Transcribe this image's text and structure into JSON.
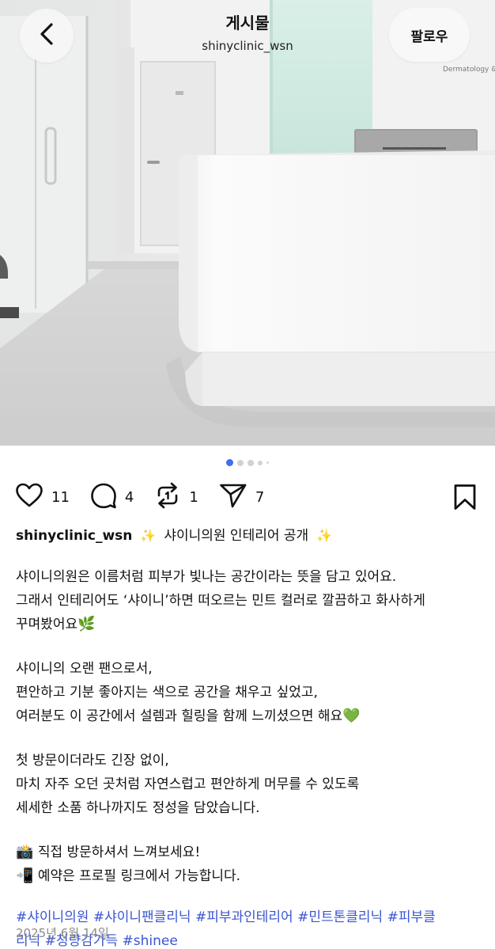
{
  "header": {
    "title": "게시물",
    "username": "shinyclinic_wsn",
    "follow_label": "팔로우"
  },
  "photo": {
    "sign_text": "Dermatology & F",
    "accent_color": "#d6ede6"
  },
  "carousel": {
    "total_dots": 5,
    "active_index": 1,
    "active_color": "#3f6ff0"
  },
  "actions": {
    "likes": "11",
    "comments": "4",
    "reposts": "1",
    "shares": "7"
  },
  "caption": {
    "username": "shinyclinic_wsn",
    "sparkle": "✨",
    "title": "샤이니의원 인테리어 공개",
    "paragraph1": [
      "샤이니의원은 이름처럼 피부가 빛나는 공간이라는 뜻을 담고 있어요.",
      "그래서 인테리어도 ‘샤이니’하면 떠오르는 민트 컬러로 깔끔하고 화사하게",
      "꾸며봤어요"
    ],
    "paragraph2": [
      "샤이니의 오랜 팬으로서,",
      "편안하고 기분 좋아지는 색으로 공간을 채우고 싶었고,",
      "여러분도 이 공간에서 설렘과 힐링을 함께 느끼셨으면 해요"
    ],
    "paragraph3": [
      "첫 방문이더라도 긴장 없이,",
      "마치 자주 오던 곳처럼 자연스럽고 편안하게 머무를 수 있도록",
      "세세한 소품 하나까지도 정성을 담았습니다."
    ],
    "paragraph4": [
      "직접 방문하셔서 느껴보세요!",
      "예약은 프로필 링크에서 가능합니다."
    ],
    "hashtags_line1": "#샤이니의원 #샤이니팬클리닉 #피부과인테리어 #민트톤클리닉 #피부클",
    "hashtags_line2": "리닉 #청량감가득 #shinee",
    "date": "2025년 6월 14일"
  },
  "icons": {
    "back": "chevron-left-icon",
    "like": "heart-icon",
    "comment": "comment-bubble-icon",
    "repost": "repost-icon",
    "share": "send-icon",
    "bookmark": "bookmark-icon"
  },
  "colors": {
    "hashtag": "#3a55d2",
    "date": "#8a8a8a",
    "mint": "#d6ede6"
  }
}
